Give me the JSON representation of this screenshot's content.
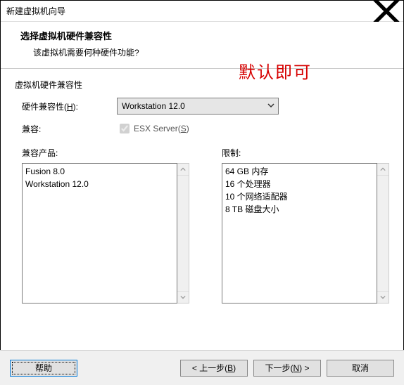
{
  "window": {
    "title": "新建虚拟机向导"
  },
  "header": {
    "heading": "选择虚拟机硬件兼容性",
    "sub": "该虚拟机需要何种硬件功能?"
  },
  "annotation": "默认即可",
  "section_label": "虚拟机硬件兼容性",
  "form": {
    "compat_label_prefix": "硬件兼容性(",
    "compat_label_key": "H",
    "compat_label_suffix": "):",
    "compat_value": "Workstation 12.0",
    "compat_with_label": "兼容:",
    "esx_checked": true,
    "esx_label_prefix": "ESX Server(",
    "esx_label_key": "S",
    "esx_label_suffix": ")"
  },
  "lists": {
    "products_label": "兼容产品:",
    "products": [
      "Fusion 8.0",
      "Workstation 12.0"
    ],
    "limits_label": "限制:",
    "limits": [
      "64 GB 内存",
      "16 个处理器",
      "10 个网络适配器",
      "8 TB 磁盘大小"
    ]
  },
  "buttons": {
    "help": "帮助",
    "back_prefix": "< 上一步(",
    "back_key": "B",
    "back_suffix": ")",
    "next_prefix": "下一步(",
    "next_key": "N",
    "next_suffix": ") >",
    "cancel": "取消"
  }
}
